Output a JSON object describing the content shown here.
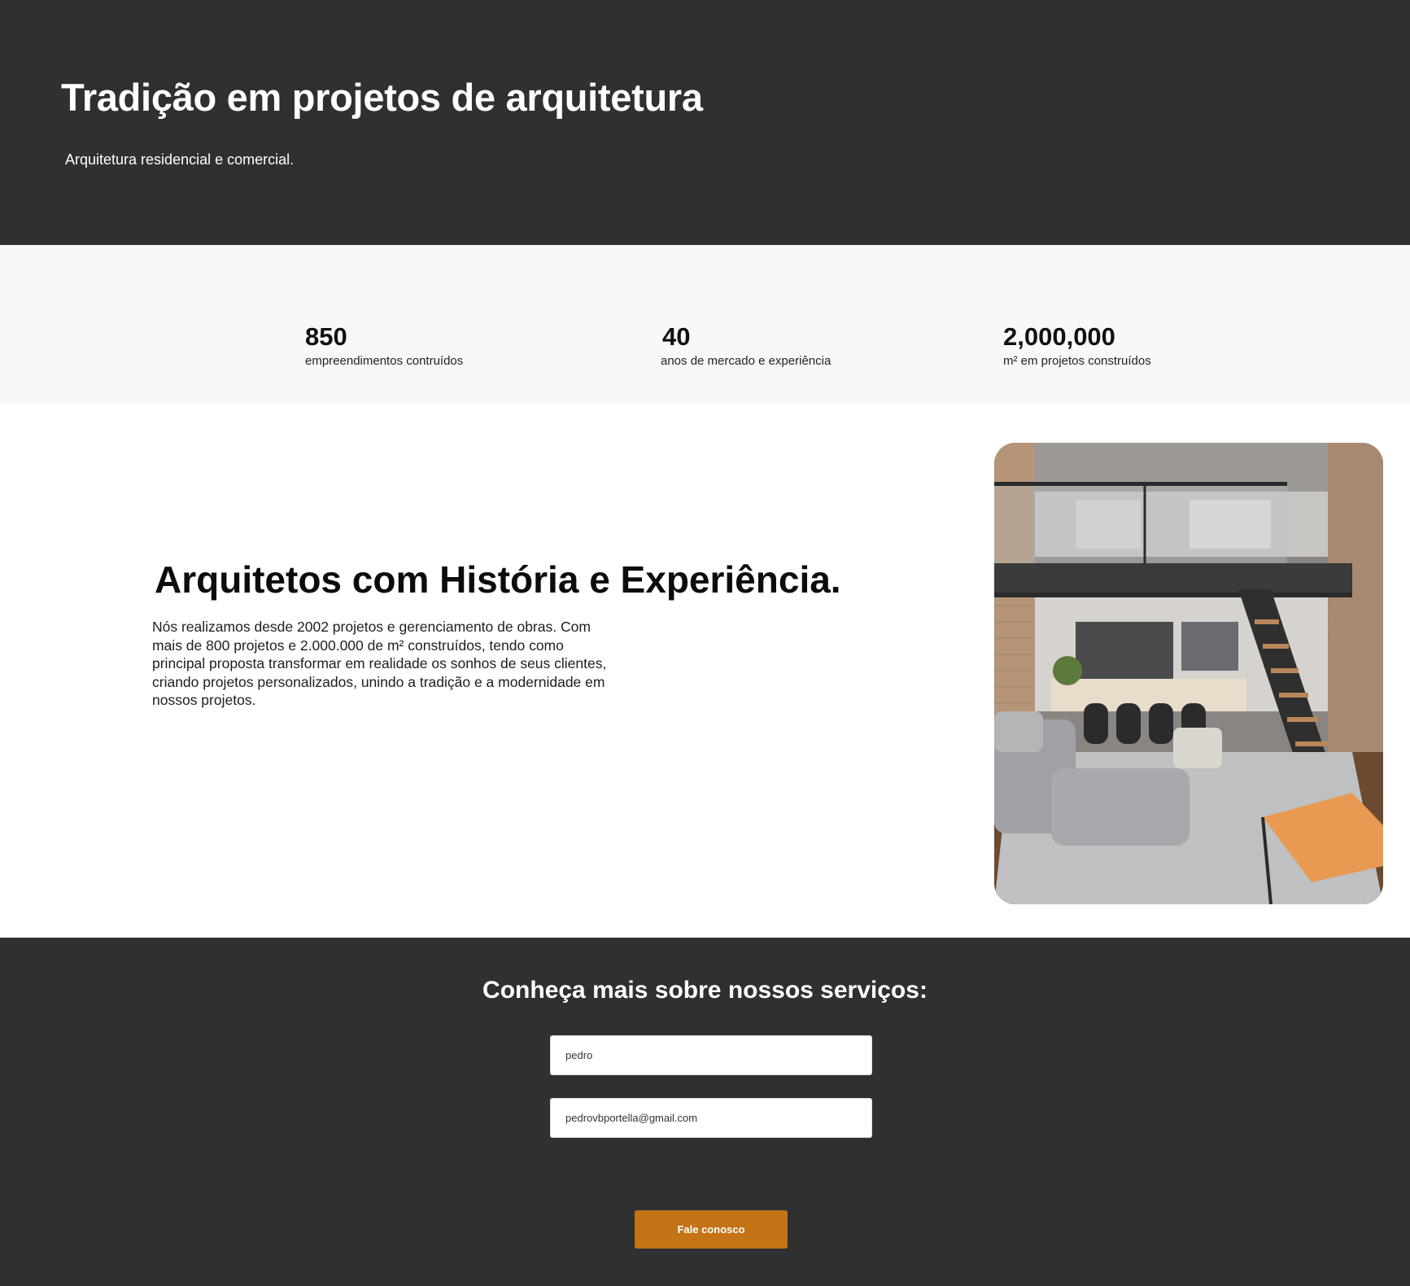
{
  "hero": {
    "title": "Tradição em projetos de arquitetura",
    "subtitle": "Arquitetura residencial e comercial."
  },
  "stats": [
    {
      "value": "850",
      "label": "empreendimentos contruídos"
    },
    {
      "value": "40",
      "label": "anos de mercado e experiência"
    },
    {
      "value": "2,000,000",
      "label": "m² em projetos construídos"
    }
  ],
  "about": {
    "heading": "Arquitetos com História e Experiência.",
    "body": "Nós realizamos desde 2002 projetos e gerenciamento de obras. Com mais de 800 projetos e 2.000.000 de m² construídos, tendo como principal proposta transformar em realidade os sonhos de seus clientes, criando projetos personalizados, unindo a tradição e a modernidade em nossos projetos."
  },
  "contact": {
    "heading": "Conheça mais sobre nossos serviços:",
    "name_value": "pedro",
    "email_value": "pedrovbportella@gmail.com",
    "button_label": "Fale conosco"
  },
  "colors": {
    "dark_bg": "#303030",
    "stats_bg": "#f8f8f8",
    "accent": "#c47316"
  }
}
